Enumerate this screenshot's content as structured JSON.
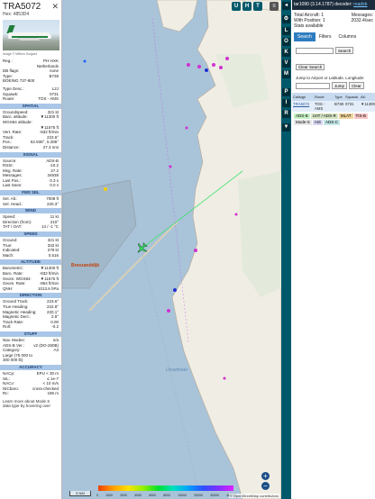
{
  "aircraft": {
    "callsign": "TRA5072",
    "hex": "Hex: 4853D4",
    "photo_credit": "Image © Willem Sorgard",
    "reg_label": "Reg.:",
    "reg": "PH-HXK",
    "country": "Netherlands",
    "dbflags_label": "DB flags:",
    "dbflags": "none",
    "type_label": "Type:",
    "type": "B738",
    "type_full": "BOEING 737-800",
    "typedesc_label": "Type Desc.:",
    "typedesc": "L2J",
    "squawk_label": "Squawk:",
    "squawk": "0731",
    "route_label": "Route:",
    "route": "TOS - AMS"
  },
  "sections": {
    "spatial": "SPATIAL",
    "signal": "SIGNAL",
    "fms": "FMS SEL",
    "wind": "WIND",
    "speed": "SPEED",
    "altitude": "ALTITUDE",
    "direction": "DIRECTION",
    "stuff": "STUFF",
    "accuracy": "ACCURACY"
  },
  "spatial": [
    {
      "k": "Groundspeed:",
      "v": "321 kt"
    },
    {
      "k": "Baro. altitude:",
      "v": "▼11300 ft"
    },
    {
      "k": "WGS84 altitude:",
      "v": ""
    },
    {
      "k": "",
      "v": "▼11575 ft"
    },
    {
      "k": "Vert. Rate:",
      "v": "-832 ft/min"
    },
    {
      "k": "Track:",
      "v": "223.6°"
    },
    {
      "k": "Pos.:",
      "v": "52.938°, 5.285°"
    },
    {
      "k": "Distance:",
      "v": "27.3 nmi"
    }
  ],
  "signal": [
    {
      "k": "Source:",
      "v": "ADS-B"
    },
    {
      "k": "RSSI:",
      "v": "-10.2"
    },
    {
      "k": "Msg. Rate:",
      "v": "27.2"
    },
    {
      "k": "Messages:",
      "v": "34938"
    },
    {
      "k": "Last Pos.:",
      "v": "0.3 s"
    },
    {
      "k": "Last Seen:",
      "v": "0.0 s"
    }
  ],
  "fms": [
    {
      "k": "Sel. Alt.:",
      "v": "7008 ft"
    },
    {
      "k": "Sel. Head.:",
      "v": "220.3°"
    }
  ],
  "wind": [
    {
      "k": "Speed:",
      "v": "11 kt"
    },
    {
      "k": "Direction (from):",
      "v": "210°"
    },
    {
      "k": "TAT / OAT:",
      "v": "14 / -1 °C"
    }
  ],
  "speed": [
    {
      "k": "Ground:",
      "v": "321 kt"
    },
    {
      "k": "True:",
      "v": "332 kt"
    },
    {
      "k": "Indicated:",
      "v": "279 kt"
    },
    {
      "k": "Mach:",
      "v": "0.516"
    }
  ],
  "altitude": [
    {
      "k": "Barometric:",
      "v": "▼11300 ft"
    },
    {
      "k": "Baro. Rate:",
      "v": "-832 ft/min"
    },
    {
      "k": "Geom. WGS84:",
      "v": "▼11575 ft"
    },
    {
      "k": "Geom. Rate:",
      "v": "-864 ft/min"
    },
    {
      "k": "QNH:",
      "v": "1013.6 hPa"
    }
  ],
  "direction": [
    {
      "k": "Ground Track:",
      "v": "223.6°"
    },
    {
      "k": "True Heading:",
      "v": "222.8°"
    },
    {
      "k": "Magnetic Heading:",
      "v": "220.1°"
    },
    {
      "k": "Magnetic Decl.:",
      "v": "2.9°"
    },
    {
      "k": "Track Rate:",
      "v": "0.00"
    },
    {
      "k": "Roll:",
      "v": "-0.2"
    }
  ],
  "stuff": [
    {
      "k": "Nav. Modes:",
      "v": "n/a"
    },
    {
      "k": "ADS-B Ver.:",
      "v": "v2 (DO-260B)"
    },
    {
      "k": "Category:",
      "v": "A3"
    },
    {
      "k": "Large (75 000 to",
      "v": ""
    },
    {
      "k": "300 000 lb)",
      "v": ""
    }
  ],
  "accuracy": [
    {
      "k": "NACp:",
      "v": "EPU < 30 m"
    },
    {
      "k": "SIL:",
      "v": "≤ 1e-7"
    },
    {
      "k": "NACv:",
      "v": "< 10 m/s"
    },
    {
      "k": "NICbaro:",
      "v": "cross-checked"
    },
    {
      "k": "Rc:",
      "v": "186 m"
    }
  ],
  "footer": "Learn more about Mode S data type by hovering over",
  "map": {
    "buttons": [
      "L",
      "O",
      "K",
      "V",
      "M",
      "P",
      "I",
      "R"
    ],
    "top_buttons": [
      "U",
      "H",
      "T"
    ],
    "scale": "5 NM",
    "alt_labels": [
      "0",
      "1000",
      "2000",
      "4000",
      "6000",
      "8000",
      "10000",
      "20000",
      "30000",
      "40000+"
    ],
    "attribution": "© OpenStreetMap contributors",
    "place_label": "Breezanddijk",
    "sea_label": "IJsselmeer"
  },
  "right": {
    "top_text": "tar1090 (3.14.1787) decoder: ",
    "top_link": "readsb",
    "total_aircraft": "Total Aircraft: 1",
    "with_position": "With Position: 1",
    "stats": "Stats available",
    "messages_label": "Messages:",
    "messages_value": "2032.4/sec",
    "tabs": [
      "Search",
      "Filters",
      "Columns"
    ],
    "search_button": "Search",
    "clear_search": "Clear Search",
    "jump_label": "Jump to Airport or Latitude, Longitude:",
    "jump_button": "Jump",
    "clear_button": "Clear",
    "table_headers": [
      "Callsign",
      "Route",
      "Type",
      "Squawk",
      "Alt."
    ],
    "table_row": [
      "TRA5072",
      "TOS - AMS",
      "B738",
      "0731",
      "▼11300"
    ],
    "legend": [
      "ADS-B",
      "UAT / ADS-R",
      "MLAT",
      "TIS-B",
      "Mode-S",
      "AIS",
      "ADS-C"
    ]
  },
  "colors": {
    "section_bg": "#a9c6e8",
    "sea": "#a9c3d9",
    "land": "#f0ede5",
    "button_teal": "#00596b",
    "accent_blue": "#2f7dc0"
  }
}
